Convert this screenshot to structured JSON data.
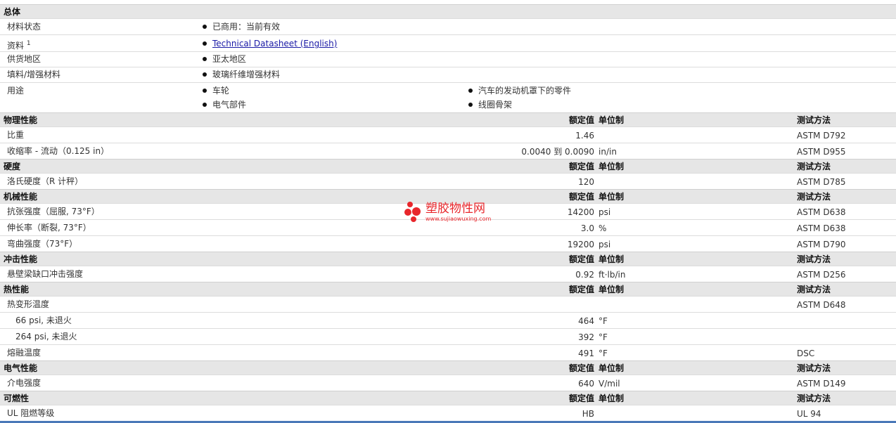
{
  "general": {
    "title": "总体",
    "rows": [
      {
        "label": "材料状态",
        "items": [
          "已商用：当前有效"
        ]
      },
      {
        "label": "资料",
        "sup": "1",
        "link": "Technical Datasheet (English)"
      },
      {
        "label": "供货地区",
        "items": [
          "亚太地区"
        ]
      },
      {
        "label": "填料/增强材料",
        "items": [
          "玻璃纤维增强材料"
        ]
      },
      {
        "label": "用途",
        "items": [
          "车轮",
          "汽车的发动机罩下的零件",
          "电气部件",
          "线圈骨架"
        ]
      }
    ]
  },
  "col_headers": {
    "value": "额定值",
    "unit": "单位制",
    "method": "测试方法"
  },
  "sections": [
    {
      "title": "物理性能",
      "rows": [
        {
          "label": "比重",
          "value": "1.46",
          "unit": "",
          "method": "ASTM D792"
        },
        {
          "label": "收缩率 - 流动（0.125 in）",
          "value": "0.0040 到 0.0090",
          "unit": "in/in",
          "method": "ASTM D955"
        }
      ]
    },
    {
      "title": "硬度",
      "rows": [
        {
          "label": "洛氏硬度（R 计秤）",
          "value": "120",
          "unit": "",
          "method": "ASTM D785"
        }
      ]
    },
    {
      "title": "机械性能",
      "rows": [
        {
          "label": "抗张强度（屈服, 73°F）",
          "value": "14200",
          "unit": "psi",
          "method": "ASTM D638"
        },
        {
          "label": "伸长率（断裂, 73°F）",
          "value": "3.0",
          "unit": "%",
          "method": "ASTM D638"
        },
        {
          "label": "弯曲强度（73°F）",
          "value": "19200",
          "unit": "psi",
          "method": "ASTM D790"
        }
      ]
    },
    {
      "title": "冲击性能",
      "rows": [
        {
          "label": "悬壁梁缺口冲击强度",
          "value": "0.92",
          "unit": "ft·lb/in",
          "method": "ASTM D256"
        }
      ]
    },
    {
      "title": "热性能",
      "rows": [
        {
          "label": "热变形温度",
          "value": "",
          "unit": "",
          "method": "ASTM D648"
        },
        {
          "label": "66 psi, 未退火",
          "value": "464",
          "unit": "°F",
          "method": "",
          "indent": true
        },
        {
          "label": "264 psi, 未退火",
          "value": "392",
          "unit": "°F",
          "method": "",
          "indent": true
        },
        {
          "label": "熔融温度",
          "value": "491",
          "unit": "°F",
          "method": "DSC"
        }
      ]
    },
    {
      "title": "电气性能",
      "rows": [
        {
          "label": "介电强度",
          "value": "640",
          "unit": "V/mil",
          "method": "ASTM D149"
        }
      ]
    },
    {
      "title": "可燃性",
      "rows": [
        {
          "label": "UL 阻燃等级",
          "value": "HB",
          "unit": "",
          "method": "UL 94"
        }
      ]
    }
  ],
  "watermark": {
    "name": "塑胶物性网",
    "url": "www.sujiaowuxing.com"
  },
  "colors": {
    "header_bg": "#e6e6e6",
    "link": "#1a1aa6",
    "watermark": "#e8262b"
  }
}
